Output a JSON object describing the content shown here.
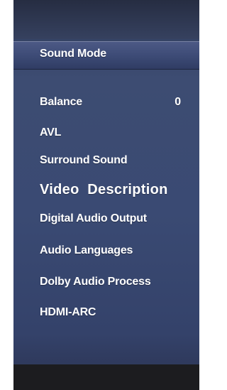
{
  "menu": {
    "items": [
      {
        "label": "Sound Mode",
        "value": ""
      },
      {
        "label": "Balance",
        "value": "0"
      },
      {
        "label": "AVL",
        "value": ""
      },
      {
        "label": "Surround Sound",
        "value": ""
      },
      {
        "label": "Video  Description",
        "value": ""
      },
      {
        "label": "Digital Audio Output",
        "value": ""
      },
      {
        "label": "Audio Languages",
        "value": ""
      },
      {
        "label": "Dolby Audio Process",
        "value": ""
      },
      {
        "label": "HDMI-ARC",
        "value": ""
      }
    ],
    "selected_index": 0
  },
  "colors": {
    "panel": "#3a4a73",
    "highlight": "#4d5a86",
    "text": "#ffffff",
    "footer": "#1c1c1f"
  }
}
